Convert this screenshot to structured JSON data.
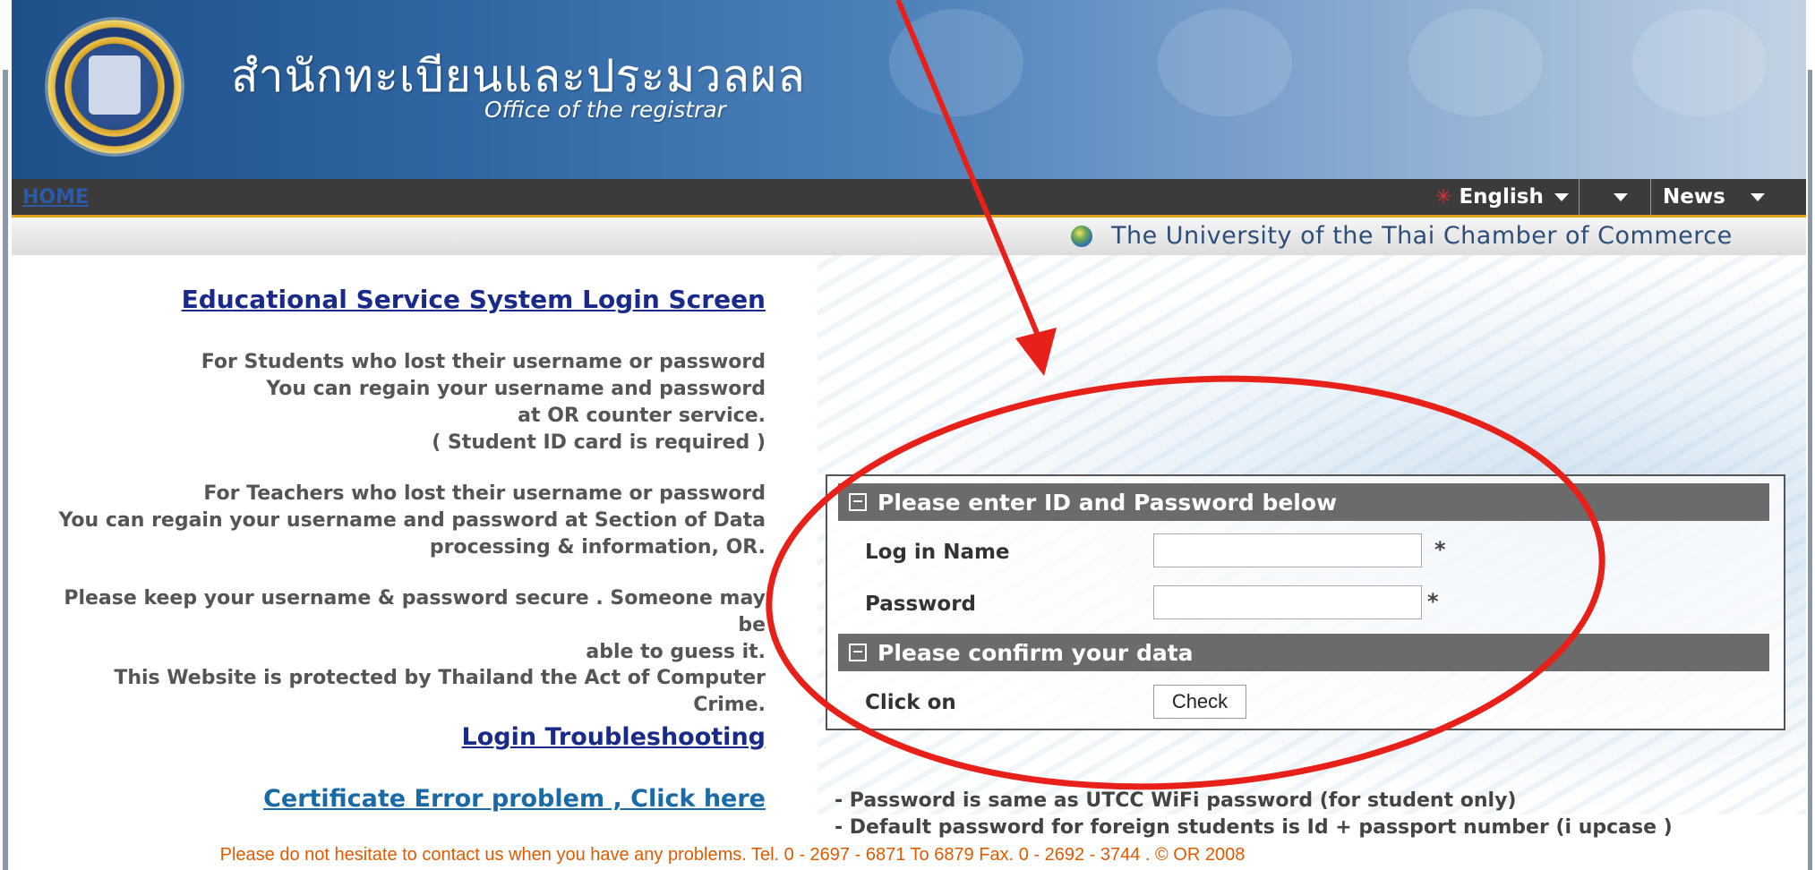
{
  "header": {
    "title_thai": "สำนักทะเบียนและประมวลผล",
    "title_english": "Office of the registrar"
  },
  "nav": {
    "home": "HOME",
    "language": "English",
    "news": "News",
    "university": "The University of the Thai Chamber of Commerce"
  },
  "left": {
    "title": "Educational Service System Login Screen",
    "students": [
      "For Students who lost their username or password",
      "You can regain your username and password",
      "at OR counter service.",
      "( Student ID card is required )"
    ],
    "teachers": [
      "For Teachers who lost their username or password",
      "You can regain your username and password at Section of Data",
      "processing & information, OR."
    ],
    "secure": [
      "Please keep your username & password secure . Someone may be",
      "able to guess it."
    ],
    "law": "This Website is protected by Thailand the Act of Computer Crime.",
    "troubleshooting": "Login Troubleshooting",
    "certificate": "Certificate Error problem , Click here"
  },
  "login": {
    "section_1": "Please enter ID and Password below",
    "name_label": "Log in Name",
    "password_label": "Password",
    "required_mark": "*",
    "section_2": "Please confirm your data",
    "click_label": "Click on",
    "check_button": "Check",
    "name_value": "",
    "password_value": ""
  },
  "notes": [
    "- Password is same as UTCC WiFi password (for student only)",
    "- Default password for foreign students is Id + passport number (i upcase )"
  ],
  "footer": "Please do not hesitate to contact us when you have any problems. Tel. 0 - 2697 - 6871 To 6879 Fax. 0 - 2692 - 3744 . © OR 2008",
  "colors": {
    "nav_bar": "#3b3b3b",
    "section_header": "#6b6b6b",
    "link": "#1a2a8a",
    "footer_text": "#e05a00",
    "annotation": "#e8201a"
  }
}
